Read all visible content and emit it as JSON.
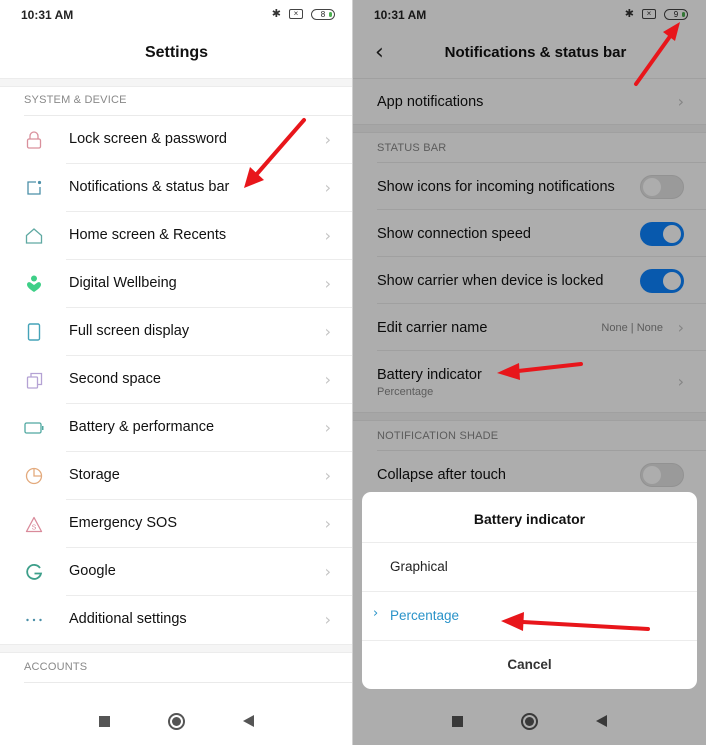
{
  "left": {
    "status": {
      "time": "10:31 AM",
      "battery_level": "8",
      "icons": [
        "bluetooth-icon",
        "sim-icon",
        "battery-icon"
      ]
    },
    "title": "Settings",
    "section_system": "SYSTEM & DEVICE",
    "items": [
      {
        "label": "Lock screen & password",
        "icon": "lock-icon",
        "color": "#d9909c"
      },
      {
        "label": "Notifications & status bar",
        "icon": "notification-icon",
        "color": "#4b8fa8"
      },
      {
        "label": "Home screen & Recents",
        "icon": "home-icon",
        "color": "#5fa9a2"
      },
      {
        "label": "Digital Wellbeing",
        "icon": "wellbeing-icon",
        "color": "#3ecf87"
      },
      {
        "label": "Full screen display",
        "icon": "phone-icon",
        "color": "#45a3b8"
      },
      {
        "label": "Second space",
        "icon": "second-space-icon",
        "color": "#b4a2d4"
      },
      {
        "label": "Battery & performance",
        "icon": "battery-icon",
        "color": "#4fa8a0"
      },
      {
        "label": "Storage",
        "icon": "storage-icon",
        "color": "#e3aa7d"
      },
      {
        "label": "Emergency SOS",
        "icon": "sos-icon",
        "color": "#d98a9a"
      },
      {
        "label": "Google",
        "icon": "google-icon",
        "color": "#3d9f8a"
      },
      {
        "label": "Additional settings",
        "icon": "more-icon",
        "color": "#4b8fa8"
      }
    ],
    "section_accounts": "ACCOUNTS",
    "chevron": "›"
  },
  "right": {
    "status": {
      "time": "10:31 AM",
      "battery_level": "9"
    },
    "title": "Notifications & status bar",
    "back": "‹",
    "app_notifications": "App notifications",
    "section_status_bar": "STATUS BAR",
    "toggles": [
      {
        "label": "Show icons for incoming notifications",
        "on": false
      },
      {
        "label": "Show connection speed",
        "on": true
      },
      {
        "label": "Show carrier when device is locked",
        "on": true
      }
    ],
    "edit_carrier": {
      "label": "Edit carrier name",
      "value": "None | None"
    },
    "battery_indicator": {
      "label": "Battery indicator",
      "value": "Percentage"
    },
    "section_notification_shade": "NOTIFICATION SHADE",
    "collapse_after_touch": {
      "label": "Collapse after touch",
      "on": false
    },
    "dialog": {
      "title": "Battery indicator",
      "options": [
        {
          "label": "Graphical",
          "selected": false
        },
        {
          "label": "Percentage",
          "selected": true
        }
      ],
      "cancel": "Cancel",
      "check_glyph": "›"
    }
  },
  "annotations": {
    "arrow_color": "#e8161b"
  }
}
